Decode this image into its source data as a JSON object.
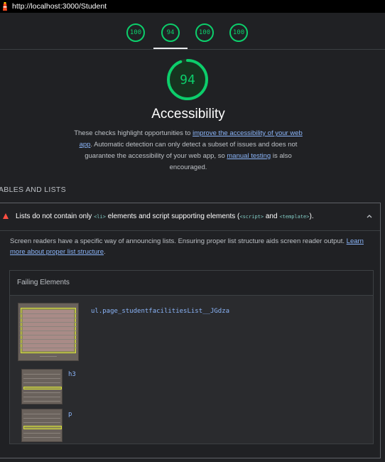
{
  "topbar": {
    "url": "http://localhost:3000/Student"
  },
  "tabs": [
    {
      "score": "100"
    },
    {
      "score": "94"
    },
    {
      "score": "100"
    },
    {
      "score": "100"
    }
  ],
  "category": {
    "score": "94",
    "score_fraction": 0.94,
    "title": "Accessibility",
    "desc_1": "These checks highlight opportunities to ",
    "desc_link_1": "improve the accessibility of your web app",
    "desc_2": ". Automatic detection can only detect a subset of issues and does not guarantee the accessibility of your web app, so ",
    "desc_link_2": "manual testing",
    "desc_3": " is also encouraged."
  },
  "group_title": "ABLES AND LISTS",
  "audit": {
    "title_1": "Lists do not contain only ",
    "code_1": "<li>",
    "title_2": " elements and script supporting elements (",
    "code_2": "<script>",
    "title_3": " and ",
    "code_3": "<template>",
    "title_4": ").",
    "desc": "Screen readers have a specific way of announcing lists. Ensuring proper list structure aids screen reader output. ",
    "desc_link": "Learn more about proper list structure",
    "desc_end": ".",
    "failing_header": "Failing Elements",
    "elements": [
      {
        "selector": "ul.page_studentfacilitiesList__JGdza"
      },
      {
        "selector": "h3"
      },
      {
        "selector": "p"
      }
    ]
  },
  "colors": {
    "pass": "#0cce6b",
    "fail": "#ff4e42",
    "link": "#8ab4f8"
  }
}
